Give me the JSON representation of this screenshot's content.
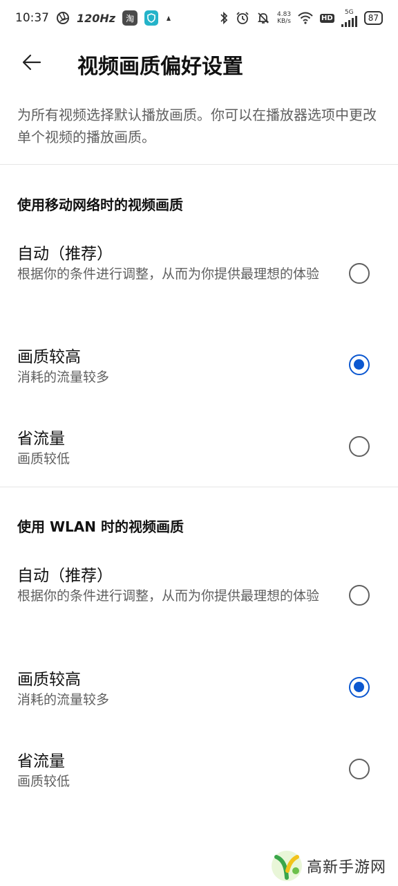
{
  "status_bar": {
    "time": "10:37",
    "refresh_rate": "120Hz",
    "app_icon_label": "淘",
    "net_speed_value": "4.83",
    "net_speed_unit": "KB/s",
    "hd_label": "HD",
    "network_label": "5G",
    "battery": "87"
  },
  "header": {
    "title": "视频画质偏好设置"
  },
  "intro": "为所有视频选择默认播放画质。你可以在播放器选项中更改单个视频的播放画质。",
  "sections": [
    {
      "title": "使用移动网络时的视频画质",
      "options": [
        {
          "title": "自动（推荐）",
          "desc": "根据你的条件进行调整，从而为你提供最理想的体验",
          "selected": false
        },
        {
          "title": "画质较高",
          "desc": "消耗的流量较多",
          "selected": true
        },
        {
          "title": "省流量",
          "desc": "画质较低",
          "selected": false
        }
      ]
    },
    {
      "title": "使用 WLAN 时的视频画质",
      "options": [
        {
          "title": "自动（推荐）",
          "desc": "根据你的条件进行调整，从而为你提供最理想的体验",
          "selected": false
        },
        {
          "title": "画质较高",
          "desc": "消耗的流量较多",
          "selected": true
        },
        {
          "title": "省流量",
          "desc": "画质较低",
          "selected": false
        }
      ]
    }
  ],
  "watermark": {
    "text": "高新手游网"
  },
  "colors": {
    "accent": "#0b57d0",
    "text_primary": "#111111",
    "text_secondary": "#5f5f5f",
    "divider": "#e6e6e6"
  }
}
